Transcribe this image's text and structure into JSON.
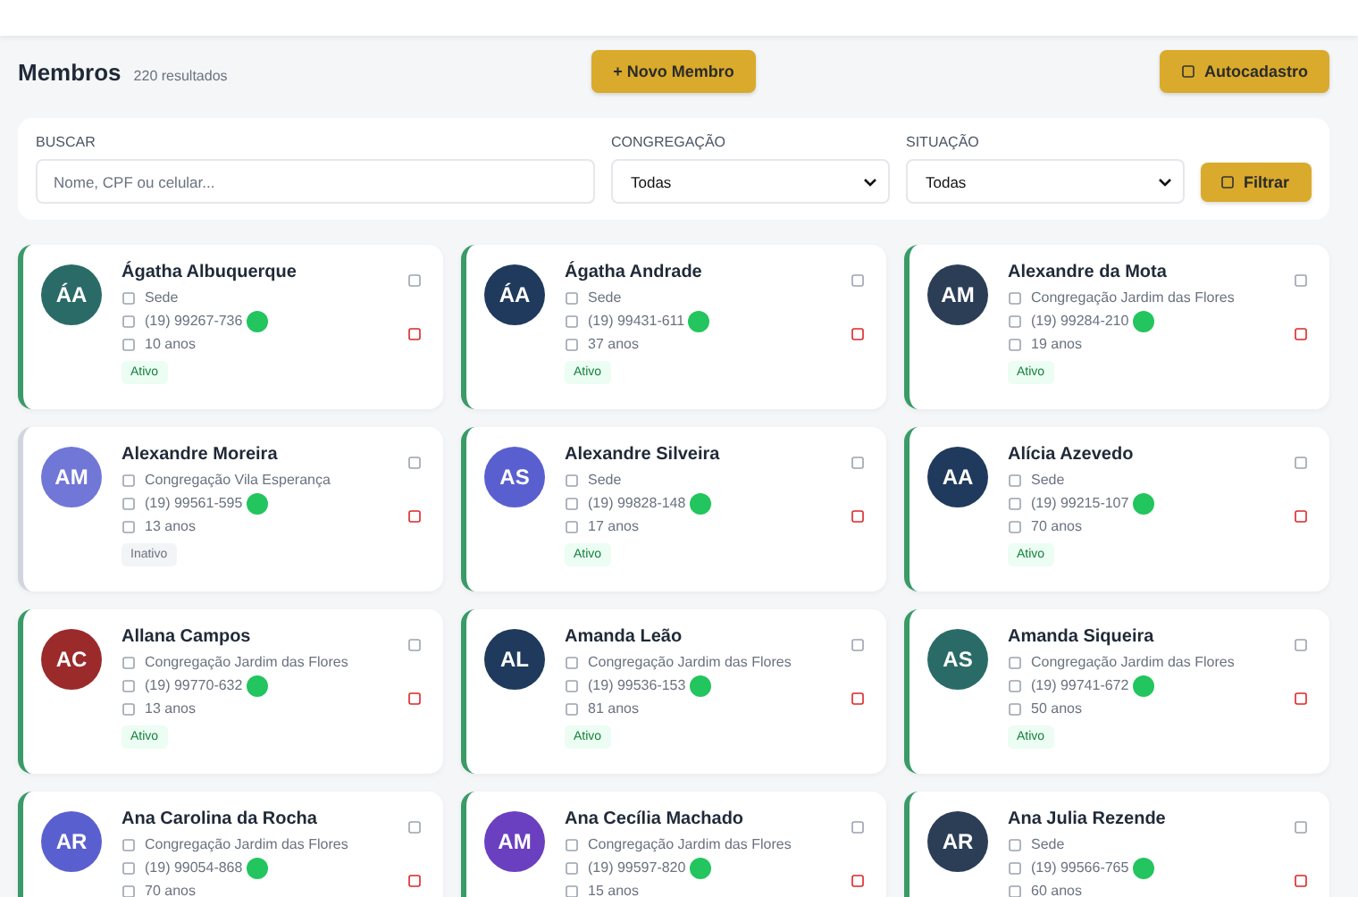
{
  "header": {
    "title": "Membros",
    "count": "220 resultados",
    "new_button": {
      "icon_text": "+",
      "label": "Novo Membro"
    },
    "self_register_button": {
      "label": "Autocadastro"
    }
  },
  "filters": {
    "search": {
      "label": "BUSCAR",
      "placeholder": "Nome, CPF ou celular..."
    },
    "congregation": {
      "label": "CONGREGAÇÃO",
      "value": "Todas"
    },
    "status": {
      "label": "SITUAÇÃO",
      "value": "Todas"
    },
    "button": {
      "label": "Filtrar"
    }
  },
  "members": [
    {
      "initials": "ÁA",
      "color": "#2a6b67",
      "name": "Ágatha Albuquerque",
      "congregation": "Sede",
      "phone": "(19) 99267-736",
      "age": "10 anos",
      "status": "Ativo",
      "active": true
    },
    {
      "initials": "ÁA",
      "color": "#1f3a5c",
      "name": "Ágatha Andrade",
      "congregation": "Sede",
      "phone": "(19) 99431-611",
      "age": "37 anos",
      "status": "Ativo",
      "active": true
    },
    {
      "initials": "AM",
      "color": "#2c3e56",
      "name": "Alexandre da Mota",
      "congregation": "Congregação Jardim das Flores",
      "phone": "(19) 99284-210",
      "age": "19 anos",
      "status": "Ativo",
      "active": true
    },
    {
      "initials": "AM",
      "color": "#7177d6",
      "name": "Alexandre Moreira",
      "congregation": "Congregação Vila Esperança",
      "phone": "(19) 99561-595",
      "age": "13 anos",
      "status": "Inativo",
      "active": false
    },
    {
      "initials": "AS",
      "color": "#5a5fd0",
      "name": "Alexandre Silveira",
      "congregation": "Sede",
      "phone": "(19) 99828-148",
      "age": "17 anos",
      "status": "Ativo",
      "active": true
    },
    {
      "initials": "AA",
      "color": "#1f3a5c",
      "name": "Alícia Azevedo",
      "congregation": "Sede",
      "phone": "(19) 99215-107",
      "age": "70 anos",
      "status": "Ativo",
      "active": true
    },
    {
      "initials": "AC",
      "color": "#9b2a2a",
      "name": "Allana Campos",
      "congregation": "Congregação Jardim das Flores",
      "phone": "(19) 99770-632",
      "age": "13 anos",
      "status": "Ativo",
      "active": true
    },
    {
      "initials": "AL",
      "color": "#1f3a5c",
      "name": "Amanda Leão",
      "congregation": "Congregação Jardim das Flores",
      "phone": "(19) 99536-153",
      "age": "81 anos",
      "status": "Ativo",
      "active": true
    },
    {
      "initials": "AS",
      "color": "#2a6b67",
      "name": "Amanda Siqueira",
      "congregation": "Congregação Jardim das Flores",
      "phone": "(19) 99741-672",
      "age": "50 anos",
      "status": "Ativo",
      "active": true
    },
    {
      "initials": "AR",
      "color": "#5a5fd0",
      "name": "Ana Carolina da Rocha",
      "congregation": "Congregação Jardim das Flores",
      "phone": "(19) 99054-868",
      "age": "70 anos",
      "active": true
    },
    {
      "initials": "AM",
      "color": "#6a3fc0",
      "name": "Ana Cecília Machado",
      "congregation": "Congregação Jardim das Flores",
      "phone": "(19) 99597-820",
      "age": "15 anos",
      "active": true
    },
    {
      "initials": "AR",
      "color": "#2c3e56",
      "name": "Ana Julia Rezende",
      "congregation": "Sede",
      "phone": "(19) 99566-765",
      "age": "60 anos",
      "active": true
    }
  ]
}
